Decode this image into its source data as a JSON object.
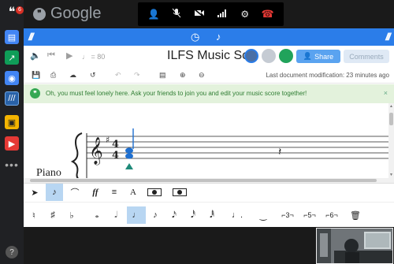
{
  "google": {
    "logo_text": "Google"
  },
  "rail": {
    "badge": "6"
  },
  "call_controls": [
    "person-add-icon",
    "mic-off-icon",
    "camera-off-icon",
    "signal-icon",
    "gear-icon",
    "hang-up-icon"
  ],
  "app": {
    "title": "ILFS Music Score",
    "tempo_label": "♩ = 80",
    "share_label": "Share",
    "comments_label": "Comments",
    "last_modification": "Last document modification: 23 minutes ago"
  },
  "banner": {
    "message": "Oh, you must feel lonely here.  Ask your friends to join you and edit your music score together!",
    "close": "×"
  },
  "score": {
    "instrument": "Piano",
    "clef": "treble",
    "key_signature": "♯",
    "time_signature": [
      "4",
      "4"
    ]
  },
  "tools1": [
    "cursor-icon",
    "note-selected",
    "fermata-icon",
    "ff",
    "",
    "A",
    "",
    "",
    ""
  ],
  "tools2": {
    "triplet": "3",
    "quintuplet": "5",
    "sextuplet": "6"
  },
  "colors": {
    "accent": "#2b7de9",
    "banner_bg": "#e3f2dc",
    "selected_tool": "#b8d6f2",
    "note_blue": "#1e6fd0",
    "cursor_green": "#1f8a79"
  }
}
